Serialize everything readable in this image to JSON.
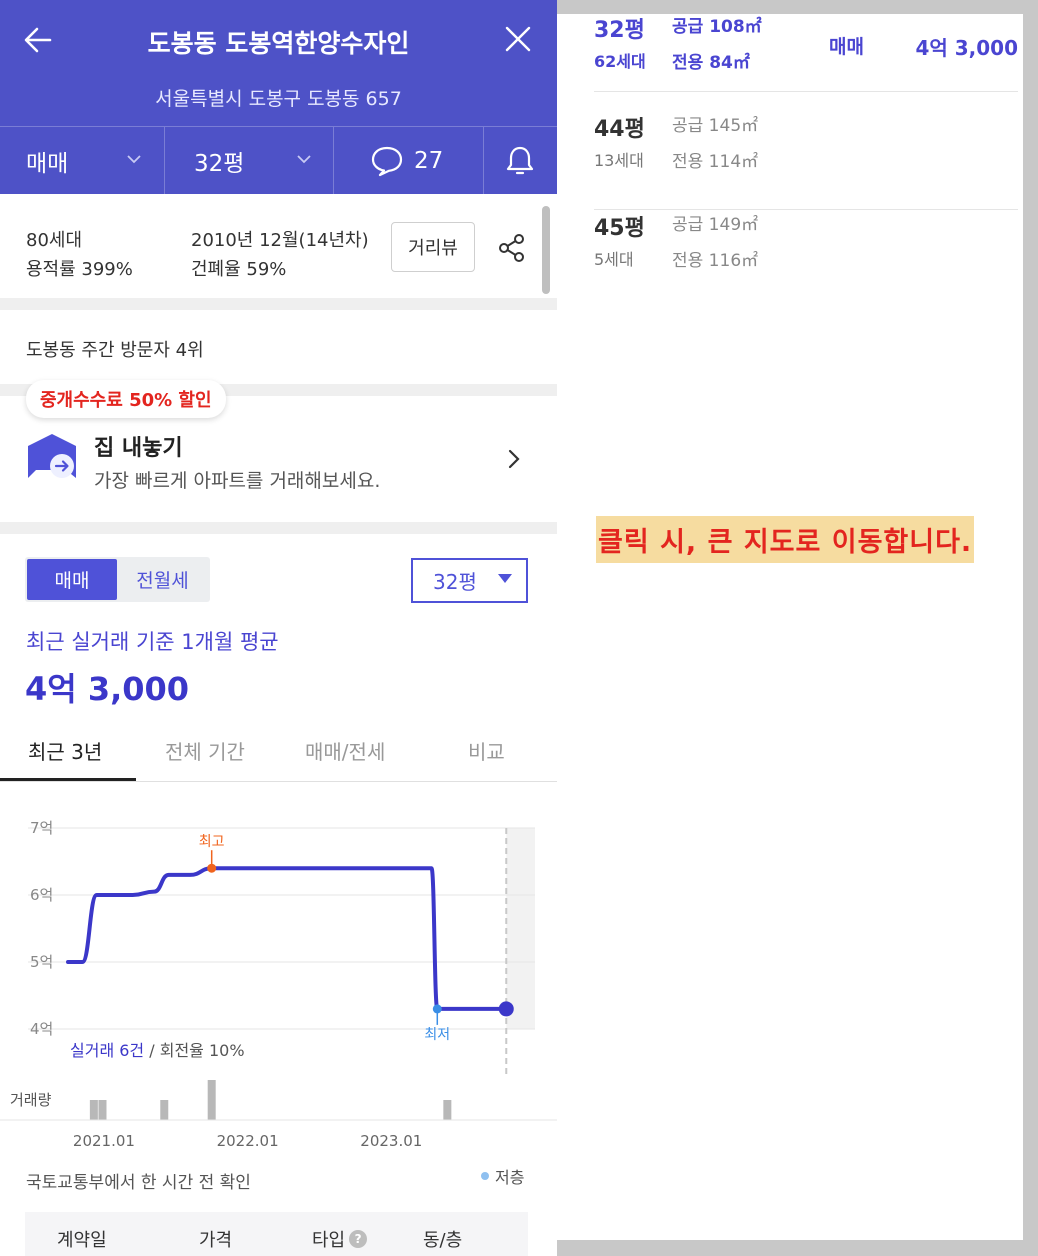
{
  "header": {
    "title": "도봉동 도봉역한양수자인",
    "address": "서울특별시 도봉구 도봉동 657",
    "tabs": {
      "trade_type": "매매",
      "size": "32평",
      "comment_count": "27"
    }
  },
  "summary": {
    "households": "80세대",
    "floor_area_ratio": "용적률 399%",
    "built": "2010년 12월(14년차)",
    "coverage_ratio": "건폐율 59%",
    "road_view_label": "거리뷰"
  },
  "visitor_rank": "도봉동 주간 방문자 4위",
  "sell": {
    "badge": "중개수수료 50% 할인",
    "title": "집 내놓기",
    "subtitle": "가장 빠르게 아파트를 거래해보세요."
  },
  "price": {
    "segments": [
      "매매",
      "전월세"
    ],
    "selected_size": "32평",
    "avg_label": "최근 실거래 기준 1개월 평균",
    "avg_value": "4억 3,000"
  },
  "period_tabs": [
    "최근 3년",
    "전체 기간",
    "매매/전세",
    "비교"
  ],
  "chart_data": {
    "type": "line",
    "x_ticks": [
      "2021.01",
      "2022.01",
      "2023.01"
    ],
    "y_ticks": [
      "7억",
      "6억",
      "5억",
      "4억"
    ],
    "ylim": [
      4,
      7
    ],
    "xlim": [
      2020.75,
      2024.0
    ],
    "series": [
      {
        "x": [
          2020.75,
          2020.85,
          2020.95,
          2021.2,
          2021.35,
          2021.45,
          2021.6,
          2021.75,
          2022.0,
          2023.0,
          2023.28,
          2023.32,
          2023.4,
          2023.8
        ],
        "values": [
          5.0,
          5.0,
          6.0,
          6.0,
          6.05,
          6.3,
          6.3,
          6.4,
          6.4,
          6.4,
          6.4,
          4.3,
          4.3,
          4.3
        ]
      }
    ],
    "annotations": {
      "high": "최고",
      "low": "최저"
    },
    "stats": {
      "count_text": "실거래 6건",
      "rate_text": " / 회전율 10%"
    },
    "volume_label": "거래량",
    "volume": [
      {
        "x": 2020.93,
        "v": 1
      },
      {
        "x": 2020.99,
        "v": 1
      },
      {
        "x": 2021.42,
        "v": 1
      },
      {
        "x": 2021.75,
        "v": 2
      },
      {
        "x": 2023.39,
        "v": 1
      }
    ]
  },
  "source_text": "국토교통부에서 한 시간 전 확인",
  "legend_low": "저층",
  "table_headers": [
    "계약일",
    "가격",
    "타입",
    "동/층"
  ],
  "size_list": [
    {
      "pyeong": "32평",
      "units": "62세대",
      "supply": "공급 108㎡",
      "exclusive": "전용 84㎡",
      "trade": "매매",
      "price": "4억 3,000",
      "active": true
    },
    {
      "pyeong": "44평",
      "units": "13세대",
      "supply": "공급 145㎡",
      "exclusive": "전용 114㎡",
      "trade": "",
      "price": "",
      "active": false
    },
    {
      "pyeong": "45평",
      "units": "5세대",
      "supply": "공급 149㎡",
      "exclusive": "전용 116㎡",
      "trade": "",
      "price": "",
      "active": false
    }
  ],
  "map_notice": "클릭 시, 큰 지도로 이동합니다.",
  "colors": {
    "brand": "#4e52c7",
    "accent": "#3b37c9",
    "high": "#f0641e",
    "low": "#3a8ee6",
    "notice_bg": "#f6dca0",
    "notice_text": "#e3251f"
  }
}
